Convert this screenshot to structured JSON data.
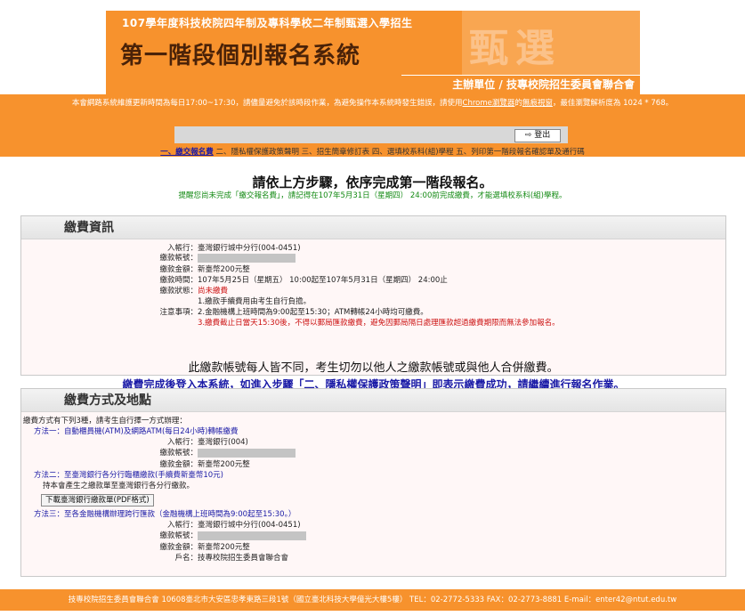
{
  "banner": {
    "top_line": "107學年度科技校院四年制及專科學校二年制甄選入學招生",
    "title": "第一階段個別報名系統",
    "sub": "主辦單位 / 技專校院招生委員會聯合會",
    "watermark": "甄選"
  },
  "notice": {
    "text_a": "本會網路系統維護更新時間為每日17:00~17:30，請儘量避免於該時段作業，為避免操作本系統時發生錯誤，請使用",
    "text_link1": "Chrome瀏覽器",
    "text_b": "的",
    "text_link2": "無痕視窗",
    "text_c": "，最佳瀏覽解析度為 1024 * 768。",
    "logout_label": "登出",
    "logout_icon": "logout-arrow-icon"
  },
  "steps": {
    "s1": "一、繳交報名費",
    "s2": "二、隱私權保護政策聲明",
    "s3": "三、招生簡章修訂表",
    "s4": "四、選填校系科(組)學程",
    "s5": "五、列印第一階段報名確認單及通行碼"
  },
  "main": {
    "heading": "請依上方步驟，依序完成第一階段報名。",
    "hint": "提醒您尚未完成「繳交報名費」，請記得在107年5月31日（星期四） 24:00前完成繳費，才能選填校系科(組)學程。"
  },
  "payment_info": {
    "title": "繳費資訊",
    "bank_label": "入帳行：",
    "bank_value": "臺灣銀行城中分行(004-0451)",
    "account_label": "繳款帳號：",
    "amount_label": "繳款金額：",
    "amount_value": "新臺幣200元整",
    "time_label": "繳款時間：",
    "time_value": "107年5月25日（星期五） 10:00起至107年5月31日（星期四） 24:00止",
    "status_label": "繳款狀態：",
    "status_value": "尚未繳費",
    "notes_label": "注意事項：",
    "note1": "1.繳款手續費用由考生自行負擔。",
    "note2": "2.金融機構上班時間為9:00起至15:30；ATM轉帳24小時均可繳費。",
    "note3": "3.繳費截止日當天15:30後，不得以郵局匯款繳費，避免因郵局隔日處理匯款超過繳費期限而無法參加報名。",
    "warn1": "此繳款帳號每人皆不同，考生切勿以他人之繳款帳號或與他人合併繳費。",
    "warn2": "繳費完成後登入本系統，如進入步驟「二、隱私權保護政策聲明」即表示繳費成功，請繼續進行報名作業。"
  },
  "payment_methods": {
    "title": "繳費方式及地點",
    "intro": "繳費方式有下列3種，請考生自行擇一方式辦理：",
    "m1": "方法一：自動櫃員機(ATM)及網路ATM(每日24小時)轉帳繳費",
    "m1_bank_label": "入帳行：",
    "m1_bank_value": "臺灣銀行(004)",
    "m1_account_label": "繳款帳號：",
    "m1_amount_label": "繳款金額：",
    "m1_amount_value": "新臺幣200元整",
    "m2": "方法二：至臺灣銀行各分行臨櫃繳款(手續費新臺幣10元)",
    "m2_desc": "持本會產生之繳款單至臺灣銀行各分行繳款。",
    "m2_button": "下載臺灣銀行繳款單(PDF格式)",
    "m3": "方法三：至各金融機構辦理跨行匯款（金融機構上班時間為9:00起至15:30。）",
    "m3_bank_label": "入帳行：",
    "m3_bank_value": "臺灣銀行城中分行(004-0451)",
    "m3_account_label": "繳款帳號：",
    "m3_amount_label": "繳款金額：",
    "m3_amount_value": "新臺幣200元整",
    "m3_name_label": "戶名：",
    "m3_name_value": "技專校院招生委員會聯合會"
  },
  "footer": {
    "text": "技專校院招生委員會聯合會 10608臺北市大安區忠孝東路三段1號（國立臺北科技大學億光大樓5樓） TEL：02-2772-5333 FAX：02-2773-8881 E-mail：enter42@ntut.edu.tw"
  }
}
